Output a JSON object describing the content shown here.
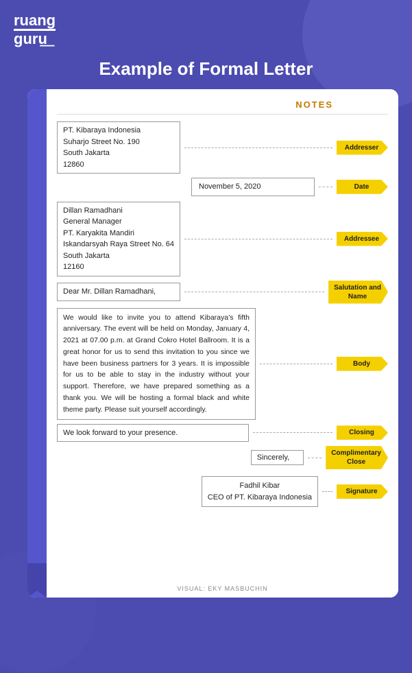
{
  "logo": {
    "line1": "ruang",
    "line2": "guru"
  },
  "page_title": "Example of Formal Letter",
  "notes_label": "NOTES",
  "sections": {
    "addresser": {
      "label": "Addresser",
      "content": "PT. Kibaraya Indonesia\nSuharjo Street No. 190\nSouth Jakarta\n12860"
    },
    "date": {
      "label": "Date",
      "content": "November 5, 2020"
    },
    "addressee": {
      "label": "Addressee",
      "content": "Dillan Ramadhani\nGeneral Manager\nPT. Karyakita Mandiri\nIskandarsyah Raya Street No. 64\nSouth Jakarta\n12160"
    },
    "salutation": {
      "label": "Salutation and\nName",
      "content": "Dear Mr. Dillan Ramadhani,"
    },
    "body": {
      "label": "Body",
      "content": "We would like to invite you to attend Kibaraya’s fifth anniversary. The event will be held on Monday, January 4, 2021 at 07.00 p.m. at Grand Cokro Hotel Ballroom. It is a great honor for us to send this invitation to you since we have been business partners for 3 years. It is impossible for us to be able to stay in the industry without your support. Therefore, we have prepared something as a thank you. We will be hosting a formal black and white theme party. Please suit yourself accordingly."
    },
    "closing": {
      "label": "Closing",
      "content": "We look forward to your presence."
    },
    "complimentary": {
      "label": "Complimentary\nClose",
      "content": "Sincerely,"
    },
    "signature": {
      "label": "Signature",
      "content": "Fadhil Kibar\nCEO of PT. Kibaraya Indonesia"
    }
  },
  "credits": "VISUAL: EKY MASBUCHIN"
}
